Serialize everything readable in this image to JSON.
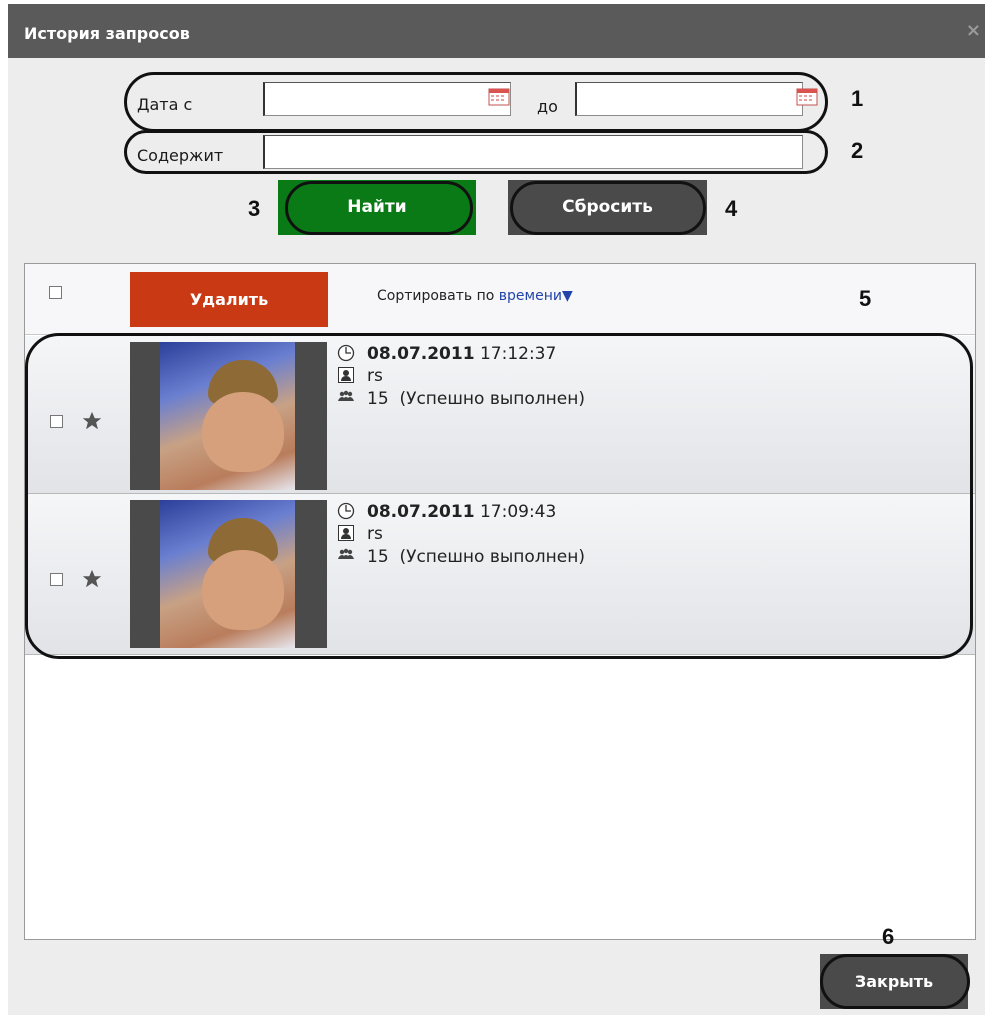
{
  "window": {
    "title": "История запросов",
    "close_symbol": "×"
  },
  "filters": {
    "date_from_label": "Дата с",
    "date_to_label": "до",
    "date_from_value": "",
    "date_to_value": "",
    "contains_label": "Содержит",
    "contains_value": ""
  },
  "actions": {
    "find_label": "Найти",
    "reset_label": "Сбросить",
    "close_label": "Закрыть"
  },
  "list": {
    "delete_label": "Удалить",
    "sort_prefix": "Сортировать по",
    "sort_field": "времени",
    "sort_arrow": "▼",
    "items": [
      {
        "date": "08.07.2011",
        "time": "17:12:37",
        "user": "rs",
        "count": "15",
        "status": "(Успешно выполнен)"
      },
      {
        "date": "08.07.2011",
        "time": "17:09:43",
        "user": "rs",
        "count": "15",
        "status": "(Успешно выполнен)"
      }
    ]
  },
  "annotations": [
    "1",
    "2",
    "3",
    "4",
    "5",
    "6"
  ],
  "colors": {
    "titlebar": "#5a5a5a",
    "find_button": "#0a7a17",
    "reset_button": "#4a4a4a",
    "delete_button": "#c93a14",
    "close_button": "#4a4a4a",
    "sort_link": "#2244aa"
  }
}
